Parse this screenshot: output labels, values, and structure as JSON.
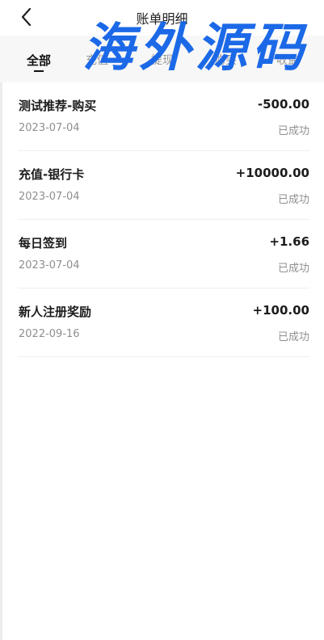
{
  "header": {
    "title": "账单明细",
    "back_icon": "chevron-left-icon"
  },
  "tabs": [
    {
      "label": "全部",
      "active": true
    },
    {
      "label": "充值",
      "active": false
    },
    {
      "label": "提现",
      "active": false
    },
    {
      "label": "购买",
      "active": false
    },
    {
      "label": "收益",
      "active": false
    }
  ],
  "watermark": "海外源码",
  "records": [
    {
      "name": "测试推荐-购买",
      "amount": "-500.00",
      "date": "2023-07-04",
      "status": "已成功"
    },
    {
      "name": "充值-银行卡",
      "amount": "+10000.00",
      "date": "2023-07-04",
      "status": "已成功"
    },
    {
      "name": "每日签到",
      "amount": "+1.66",
      "date": "2023-07-04",
      "status": "已成功"
    },
    {
      "name": "新人注册奖励",
      "amount": "+100.00",
      "date": "2022-09-16",
      "status": "已成功"
    }
  ]
}
